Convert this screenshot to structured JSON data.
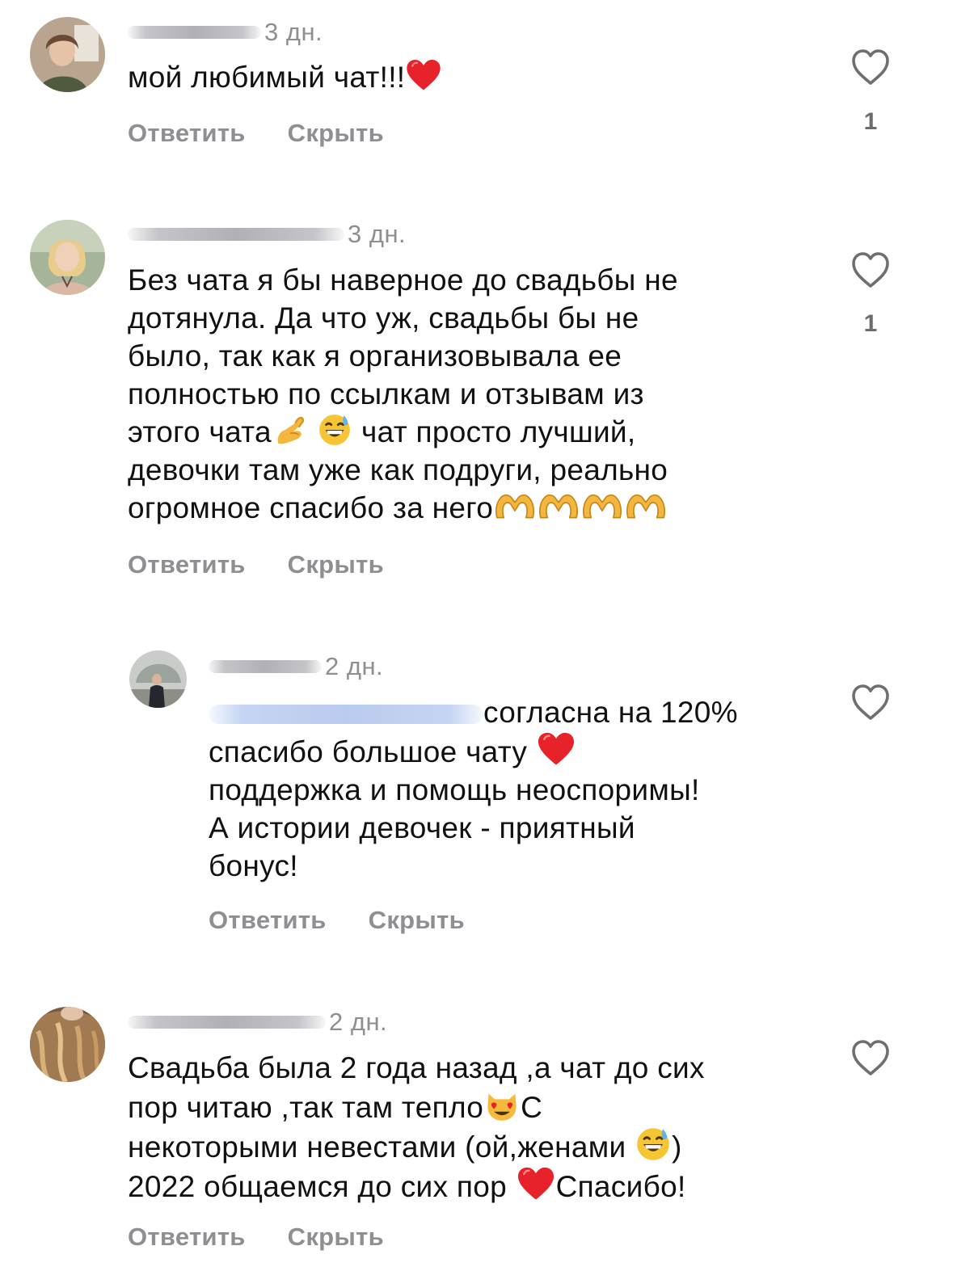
{
  "actions": {
    "reply_label": "Ответить",
    "hide_label": "Скрыть"
  },
  "colors": {
    "text": "#111111",
    "secondary": "#8e8e93",
    "heart_red": "#e8222a",
    "mention_blur": "#c5d5f3"
  },
  "comments": [
    {
      "time": "3 дн.",
      "text_1": "мой любимый чат!!!",
      "like_count": "1",
      "emojis": [
        "red-heart"
      ]
    },
    {
      "time": "3 дн.",
      "lines": [
        "Без чата я бы наверное до свадьбы не",
        "дотянула. Да что уж, свадьбы бы не",
        "было, так как я организовывала ее",
        "полностью по ссылкам и отзывам из"
      ],
      "line5_a": "этого чата",
      "line5_b": " чат просто лучший,",
      "line6": "девочки там уже как подруги, реально",
      "line7": "огромное спасибо за него",
      "like_count": "1",
      "emojis": [
        "pinching-hand",
        "grinning-sweat-face",
        "heart-hands"
      ]
    },
    {
      "time": "2 дн.",
      "mention_tail": "согласна на 120%",
      "line2": "спасибо большое чату ",
      "lines": [
        "поддержка и помощь неоспоримы!",
        "А истории девочек - приятный",
        "бонус!"
      ],
      "emojis": [
        "red-heart"
      ]
    },
    {
      "time": "2 дн.",
      "line1": "Свадьба была 2 года назад ,а чат до сих",
      "line2_a": "пор читаю ,так там тепло",
      "line2_b": "С",
      "line3_a": "некоторыми невестами (ой,женами ",
      "line3_b": ")",
      "line4_a": "2022 общаемся до сих пор ",
      "line4_b": "Спасибо!",
      "emojis": [
        "heart-eyes-cat",
        "grinning-sweat-face",
        "red-heart"
      ]
    }
  ]
}
